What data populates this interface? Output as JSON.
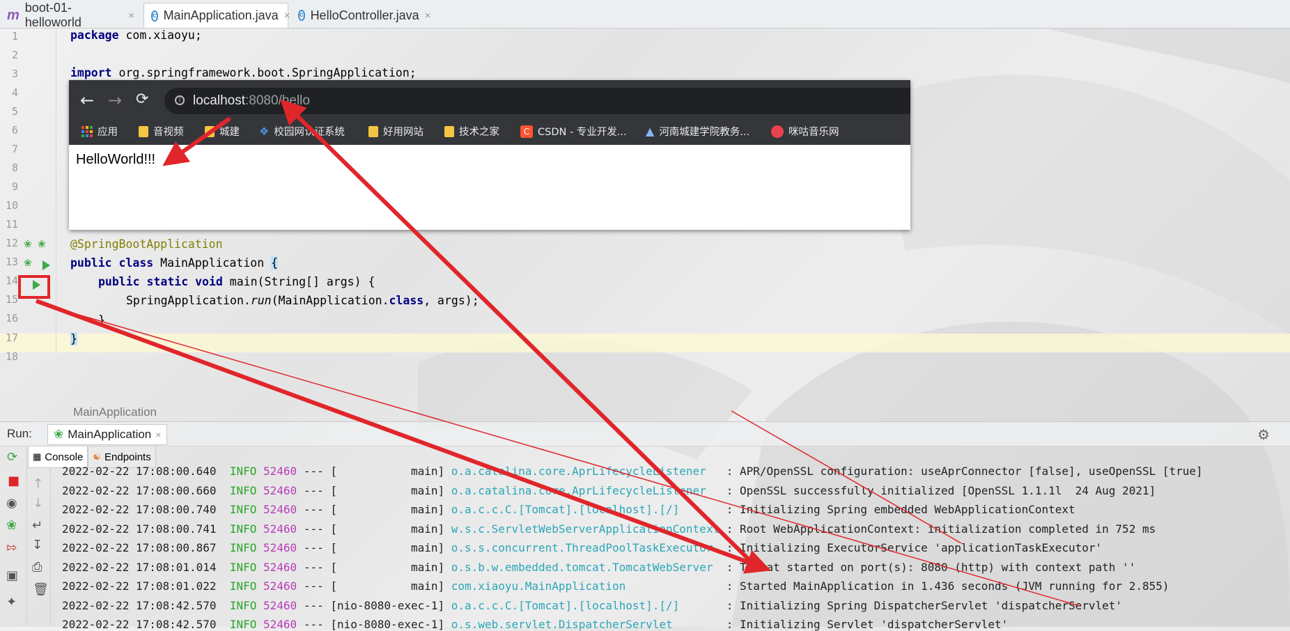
{
  "tabs": [
    {
      "label": "boot-01-helloworld",
      "icon": "m"
    },
    {
      "label": "MainApplication.java",
      "icon": "c",
      "active": true
    },
    {
      "label": "HelloController.java",
      "icon": "c"
    }
  ],
  "tab_close_glyph": "×",
  "editor": {
    "line_numbers": [
      "1",
      "2",
      "3",
      "4",
      "5",
      "6",
      "7",
      "8",
      "9",
      "10",
      "11",
      "12",
      "13",
      "14",
      "15",
      "16",
      "17",
      "18"
    ],
    "line1": {
      "kw": "package",
      "rest": " com.xiaoyu;"
    },
    "line3": {
      "kw": "import",
      "rest": " org.springframework.boot.SpringApplication;"
    },
    "line12": "@SpringBootApplication",
    "line13": {
      "kw1": "public",
      "kw2": "class",
      "name": " MainApplication ",
      "brace": "{"
    },
    "line14": {
      "kw1": "public",
      "kw2": "static",
      "kw3": "void",
      "rest": " main(String[] args) {"
    },
    "line15": {
      "pre": "SpringApplication.",
      "method": "run",
      "mid": "(MainApplication.",
      "kw": "class",
      "post": ", args);"
    },
    "line16": "}",
    "line17": "}"
  },
  "breadcrumb": "MainApplication",
  "run_panel": {
    "label": "Run:",
    "tab": "MainApplication",
    "subtabs": [
      "Console",
      "Endpoints"
    ]
  },
  "console": [
    {
      "ts": "2022-02-22 17:08:00.640",
      "level": "INFO",
      "pid": "52460",
      "sep": "---",
      "thread": "[           main]",
      "logger": "o.a.catalina.core.AprLifecycleListener  ",
      "msg": ": APR/OpenSSL configuration: useAprConnector [false], useOpenSSL [true]"
    },
    {
      "ts": "2022-02-22 17:08:00.660",
      "level": "INFO",
      "pid": "52460",
      "sep": "---",
      "thread": "[           main]",
      "logger": "o.a.catalina.core.AprLifecycleListener  ",
      "msg": ": OpenSSL successfully initialized [OpenSSL 1.1.1l  24 Aug 2021]"
    },
    {
      "ts": "2022-02-22 17:08:00.740",
      "level": "INFO",
      "pid": "52460",
      "sep": "---",
      "thread": "[           main]",
      "logger": "o.a.c.c.C.[Tomcat].[localhost].[/]      ",
      "msg": ": Initializing Spring embedded WebApplicationContext"
    },
    {
      "ts": "2022-02-22 17:08:00.741",
      "level": "INFO",
      "pid": "52460",
      "sep": "---",
      "thread": "[           main]",
      "logger": "w.s.c.ServletWebServerApplicationContext",
      "msg": ": Root WebApplicationContext: initialization completed in 752 ms"
    },
    {
      "ts": "2022-02-22 17:08:00.867",
      "level": "INFO",
      "pid": "52460",
      "sep": "---",
      "thread": "[           main]",
      "logger": "o.s.s.concurrent.ThreadPoolTaskExecutor ",
      "msg": ": Initializing ExecutorService 'applicationTaskExecutor'"
    },
    {
      "ts": "2022-02-22 17:08:01.014",
      "level": "INFO",
      "pid": "52460",
      "sep": "---",
      "thread": "[           main]",
      "logger": "o.s.b.w.embedded.tomcat.TomcatWebServer ",
      "msg": ": Tomcat started on port(s): 8080 (http) with context path ''"
    },
    {
      "ts": "2022-02-22 17:08:01.022",
      "level": "INFO",
      "pid": "52460",
      "sep": "---",
      "thread": "[           main]",
      "logger": "com.xiaoyu.MainApplication              ",
      "msg": ": Started MainApplication in 1.436 seconds (JVM running for 2.855)"
    },
    {
      "ts": "2022-02-22 17:08:42.570",
      "level": "INFO",
      "pid": "52460",
      "sep": "---",
      "thread": "[nio-8080-exec-1]",
      "logger": "o.a.c.c.C.[Tomcat].[localhost].[/]      ",
      "msg": ": Initializing Spring DispatcherServlet 'dispatcherServlet'"
    },
    {
      "ts": "2022-02-22 17:08:42.570",
      "level": "INFO",
      "pid": "52460",
      "sep": "---",
      "thread": "[nio-8080-exec-1]",
      "logger": "o.s.web.servlet.DispatcherServlet       ",
      "msg": ": Initializing Servlet 'dispatcherServlet'"
    }
  ],
  "browser": {
    "url_host": "localhost",
    "url_rest": ":8080/hello",
    "bookmarks": [
      "应用",
      "音视频",
      "城建",
      "校园网认证系统",
      "好用网站",
      "技术之家",
      "CSDN - 专业开发...",
      "河南城建学院教务...",
      "咪咕音乐网"
    ],
    "page_text": "HelloWorld!!!"
  },
  "colors": {
    "annotation_red": "#e0262b",
    "run_green": "#3ea84a",
    "keyword": "#000080",
    "info": "#2aa52a",
    "pid": "#b73cb7",
    "logger": "#2ba6b8"
  }
}
